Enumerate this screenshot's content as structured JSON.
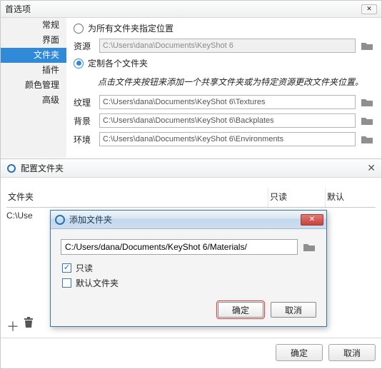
{
  "pref": {
    "title": "首选项",
    "sidebar": [
      "常规",
      "界面",
      "文件夹",
      "插件",
      "颜色管理",
      "高级"
    ],
    "radio_all": "为所有文件夹指定位置",
    "radio_each": "定制各个文件夹",
    "res_label": "资源",
    "res_path": "C:\\Users\\dana\\Documents\\KeyShot 6",
    "hint": "点击文件夹按钮来添加一个共享文件夹或为特定资源更改文件夹位置。",
    "rows": {
      "tex_label": "纹理",
      "tex_path": "C:\\Users\\dana\\Documents\\KeyShot 6\\Textures",
      "bg_label": "背景",
      "bg_path": "C:\\Users\\dana\\Documents\\KeyShot 6\\Backplates",
      "env_label": "环境",
      "env_path": "C:\\Users\\dana\\Documents\\KeyShot 6\\Environments"
    }
  },
  "cfg": {
    "title": "配置文件夹",
    "cols": {
      "c1": "文件夹",
      "c2": "只读",
      "c3": "默认"
    },
    "list_row": "C:\\Use",
    "btn_ok": "确定",
    "btn_cancel": "取消"
  },
  "modal": {
    "title": "添加文件夹",
    "path": "C:/Users/dana/Documents/KeyShot 6/Materials/",
    "chk_readonly": "只读",
    "chk_default": "默认文件夹",
    "btn_ok": "确定",
    "btn_cancel": "取消"
  }
}
